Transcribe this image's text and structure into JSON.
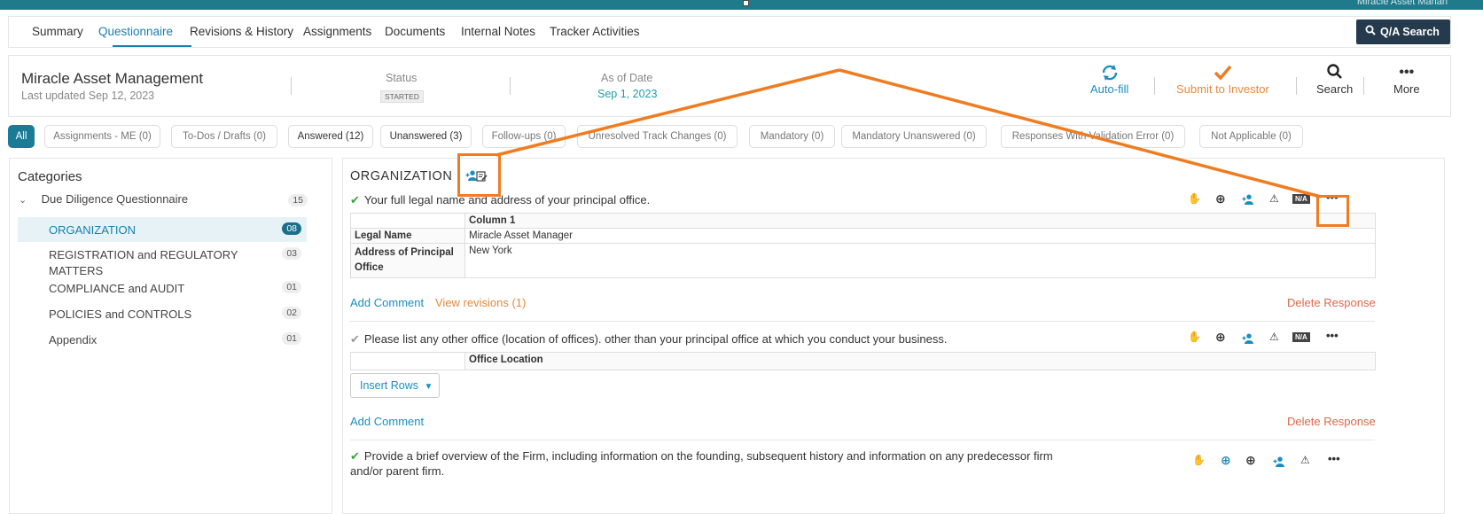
{
  "topbar": {
    "user": "Miracle Asset Manan"
  },
  "tabs": [
    {
      "label": "Summary",
      "active": false
    },
    {
      "label": "Questionnaire",
      "active": true
    },
    {
      "label": "Revisions & History",
      "active": false
    },
    {
      "label": "Assignments",
      "active": false
    },
    {
      "label": "Documents",
      "active": false
    },
    {
      "label": "Internal Notes",
      "active": false
    },
    {
      "label": "Tracker Activities",
      "active": false
    }
  ],
  "qa_search": {
    "label": "Q/A Search",
    "icon": "search-icon"
  },
  "header": {
    "entity": "Miracle Asset Management",
    "updated": "Last updated Sep 12, 2023",
    "status_label": "Status",
    "status_value": "STARTED",
    "asof_label": "As of Date",
    "asof_value": "Sep 1, 2023",
    "actions": [
      {
        "label": "Auto-fill",
        "icon": "refresh-icon",
        "color": "#1a8ec0"
      },
      {
        "label": "Submit to Investor",
        "icon": "checkmark-icon",
        "color": "#e58a3c"
      },
      {
        "label": "Search",
        "icon": "search-icon",
        "color": "#333333"
      },
      {
        "label": "More",
        "icon": "ellipsis-icon",
        "color": "#333333"
      }
    ]
  },
  "filters": [
    {
      "label": "All"
    },
    {
      "label": "Assignments - ME (0)"
    },
    {
      "label": "To-Dos / Drafts (0)"
    },
    {
      "label": "Answered (12)"
    },
    {
      "label": "Unanswered (3)"
    },
    {
      "label": "Follow-ups (0)"
    },
    {
      "label": "Unresolved Track Changes (0)"
    },
    {
      "label": "Mandatory (0)"
    },
    {
      "label": "Mandatory Unanswered (0)"
    },
    {
      "label": "Responses With Validation Error (0)"
    },
    {
      "label": "Not Applicable (0)"
    }
  ],
  "categories": {
    "title": "Categories",
    "root": {
      "label": "Due Diligence Questionnaire",
      "count": "15"
    },
    "items": [
      {
        "label": "ORGANIZATION",
        "count": "08",
        "active": true
      },
      {
        "label": "REGISTRATION and REGULATORY MATTERS",
        "count": "03",
        "active": false
      },
      {
        "label": "COMPLIANCE and AUDIT",
        "count": "01",
        "active": false
      },
      {
        "label": "POLICIES and CONTROLS",
        "count": "02",
        "active": false
      },
      {
        "label": "Appendix",
        "count": "01",
        "active": false
      }
    ]
  },
  "section": {
    "title": "ORGANIZATION",
    "questions": [
      {
        "text": "Your full legal name and address of your principal office.",
        "table": {
          "column_header": "Column 1",
          "rows": [
            {
              "label": "Legal Name",
              "value": "Miracle Asset Manager"
            },
            {
              "label": "Address of Principal Office",
              "value": "New York"
            }
          ]
        },
        "add_comment": "Add Comment",
        "view_revisions": "View revisions (1)",
        "delete": "Delete Response",
        "na": "N/A"
      },
      {
        "text": "Please list any other office (location of offices). other than your principal office at which you conduct your business.",
        "table": {
          "column_header": "Office Location"
        },
        "insert_rows": "Insert Rows",
        "add_comment": "Add Comment",
        "delete": "Delete Response",
        "na": "N/A"
      },
      {
        "text_line1": "Provide a brief overview of the Firm, including information on the founding, subsequent history and information on any predecessor firm",
        "text_line2": "and/or parent firm."
      }
    ]
  },
  "colors": {
    "teal_bar": "#1f7a8c",
    "link_blue": "#1a8ec0",
    "annotation_orange": "#f07c22",
    "answered_check": "#3aa53a"
  }
}
